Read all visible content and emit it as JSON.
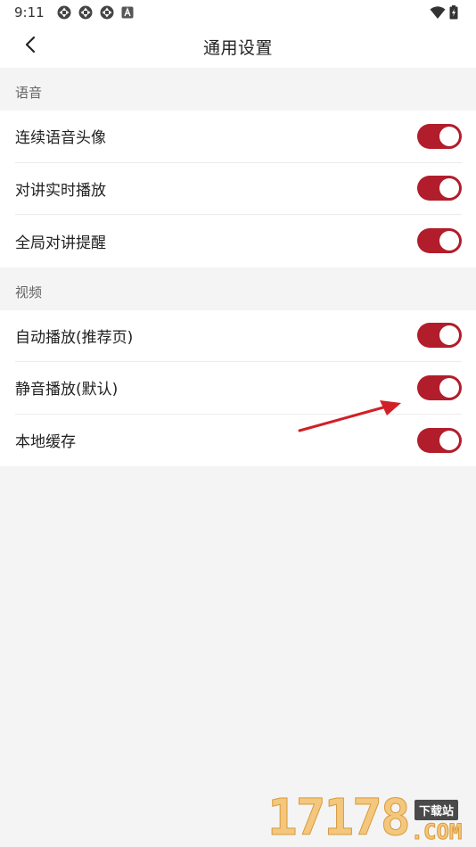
{
  "status_bar": {
    "time": "9:11",
    "icons": [
      "sync-icon",
      "sync-icon",
      "sync-icon",
      "a-app-icon"
    ],
    "right_icons": [
      "wifi-icon",
      "battery-charging-icon"
    ]
  },
  "header": {
    "title": "通用设置",
    "back_icon": "chevron-left-icon"
  },
  "sections": {
    "voice": {
      "title": "语音",
      "items": [
        {
          "label": "连续语音头像",
          "enabled": true
        },
        {
          "label": "对讲实时播放",
          "enabled": true
        },
        {
          "label": "全局对讲提醒",
          "enabled": true
        }
      ]
    },
    "video": {
      "title": "视频",
      "items": [
        {
          "label": "自动播放(推荐页)",
          "enabled": true
        },
        {
          "label": "静音播放(默认)",
          "enabled": true
        },
        {
          "label": "本地缓存",
          "enabled": true
        }
      ]
    }
  },
  "colors": {
    "toggle_on": "#b21d2b",
    "background": "#f4f4f4",
    "annotation_arrow": "#d21f26"
  },
  "watermark": {
    "digits": "17178",
    "badge": "下载站",
    "suffix": ".COM"
  }
}
